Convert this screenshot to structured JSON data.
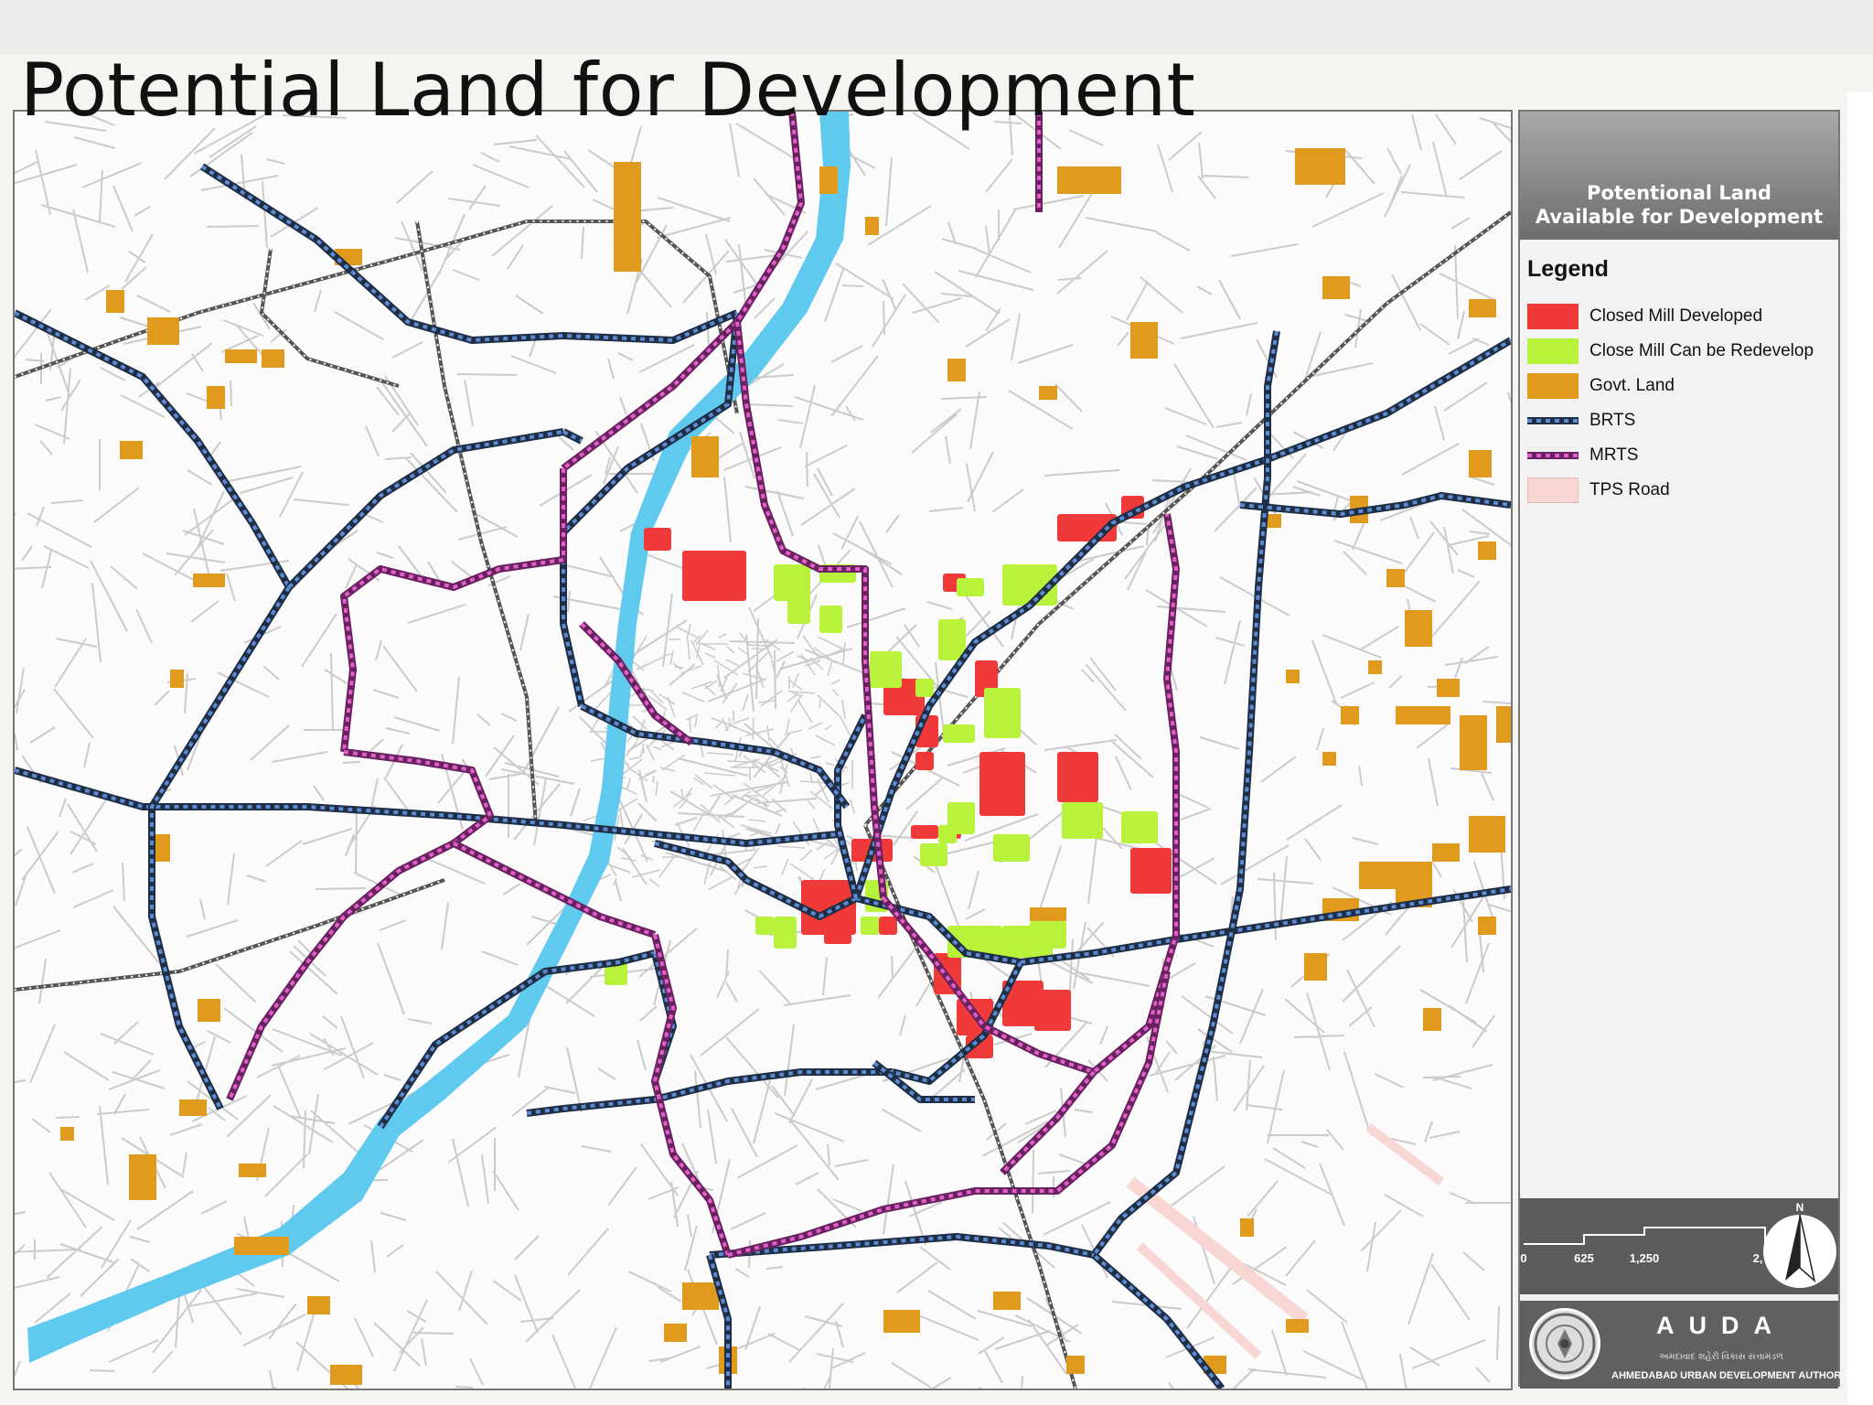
{
  "slide": {
    "title": "Potential Land for Development"
  },
  "panel": {
    "header_line1": "Potentional Land",
    "header_line2": "Available for Development",
    "legend_title": "Legend",
    "legend": [
      {
        "label": "Closed Mill Developed",
        "color": "#f03a3a",
        "kind": "fill"
      },
      {
        "label": "Close Mill Can be Redevelop",
        "color": "#b9f23a",
        "kind": "fill"
      },
      {
        "label": "Govt. Land",
        "color": "#e09a1d",
        "kind": "fill"
      },
      {
        "label": "BRTS",
        "color": "#1e2e45",
        "kind": "line"
      },
      {
        "label": "MRTS",
        "color": "#8a2a78",
        "kind": "line"
      },
      {
        "label": "TPS Road",
        "color": "#f8d6d4",
        "kind": "fill"
      }
    ],
    "scale_labels": [
      "0",
      "625",
      "1,250",
      "2,"
    ],
    "north_label": "N",
    "org_name": "AUDA",
    "org_subtitle": "અમદાવાદ શહેરી વિકાસ સત્તામંડળ",
    "org_full_name": "AHMEDABAD URBAN DEVELOPMENT AUTHORITY"
  },
  "map": {
    "colors": {
      "river": "#5fcaee",
      "street": "#cbcbcb",
      "brts": "#1e2e45",
      "brts_dash": "#5d8ad2",
      "mrts": "#6a2160",
      "mrts_dash": "#e05fc8",
      "closed_mill": "#f03a3a",
      "redevelop_mill": "#b9f23a",
      "govt_land": "#e09a1d",
      "tps_road": "#f8d6d4",
      "rail": "#555555"
    }
  }
}
